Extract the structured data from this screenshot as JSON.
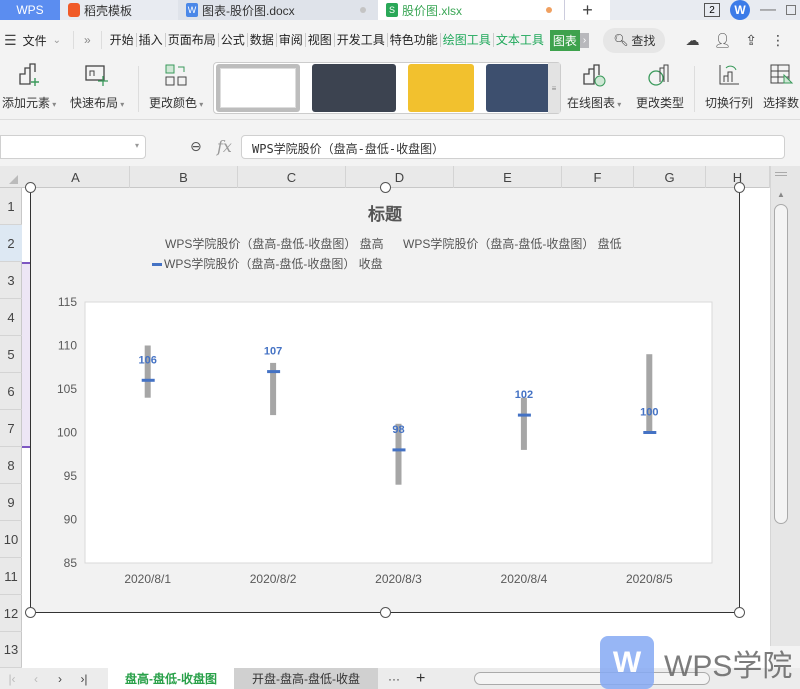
{
  "tabs": {
    "wps": "WPS",
    "docer": "稻壳模板",
    "doc": "图表-股价图.docx",
    "xlsx": "股价图.xlsx",
    "add": "+",
    "badge": "2",
    "doc_dot_color": "#c4c4c4",
    "xlsx_dot_color": "#f0a060"
  },
  "menu": {
    "file": "文件",
    "items": [
      "开始",
      "插入",
      "页面布局",
      "公式",
      "数据",
      "审阅",
      "视图",
      "开发工具",
      "特色功能"
    ],
    "green_items": [
      "绘图工具",
      "文本工具"
    ],
    "active": "图表",
    "search": "查找"
  },
  "ribbon": {
    "add_element": "添加元素",
    "quick_layout": "快速布局",
    "change_color": "更改颜色",
    "online_chart": "在线图表",
    "change_type": "更改类型",
    "switch_row_col": "切换行列",
    "select_data": "选择数"
  },
  "formula": {
    "fx": "fx",
    "value": "WPS学院股价（盘高-盘低-收盘图）"
  },
  "columns": [
    "A",
    "B",
    "C",
    "D",
    "E",
    "F",
    "G",
    "H"
  ],
  "rows": [
    "1",
    "2",
    "3",
    "4",
    "5",
    "6",
    "7",
    "8",
    "9",
    "10",
    "11",
    "12",
    "13"
  ],
  "chart_data": {
    "type": "stock-hlc",
    "title": "标题",
    "legend": [
      "WPS学院股价（盘高-盘低-收盘图） 盘高",
      "WPS学院股价（盘高-盘低-收盘图） 盘低",
      "WPS学院股价（盘高-盘低-收盘图） 收盘"
    ],
    "legend_position": "top",
    "categories": [
      "2020/8/1",
      "2020/8/2",
      "2020/8/3",
      "2020/8/4",
      "2020/8/5"
    ],
    "series": [
      {
        "name": "盘高",
        "values": [
          110,
          108,
          101,
          104,
          109
        ]
      },
      {
        "name": "盘低",
        "values": [
          104,
          102,
          94,
          98,
          100
        ]
      },
      {
        "name": "收盘",
        "values": [
          106,
          107,
          98,
          102,
          100
        ]
      }
    ],
    "data_labels": [
      "106",
      "107",
      "98",
      "102",
      "100"
    ],
    "ylim": [
      85,
      115
    ],
    "yticks": [
      "85",
      "90",
      "95",
      "100",
      "105",
      "110",
      "115"
    ],
    "colors": {
      "hilo": "#a6a6a6",
      "close": "#4472c4",
      "label": "#4472c4"
    }
  },
  "sheets": {
    "active": "盘高-盘低-收盘图",
    "other": "开盘-盘高-盘低-收盘",
    "more": "···",
    "add": "+"
  },
  "watermark": "WPS学院"
}
